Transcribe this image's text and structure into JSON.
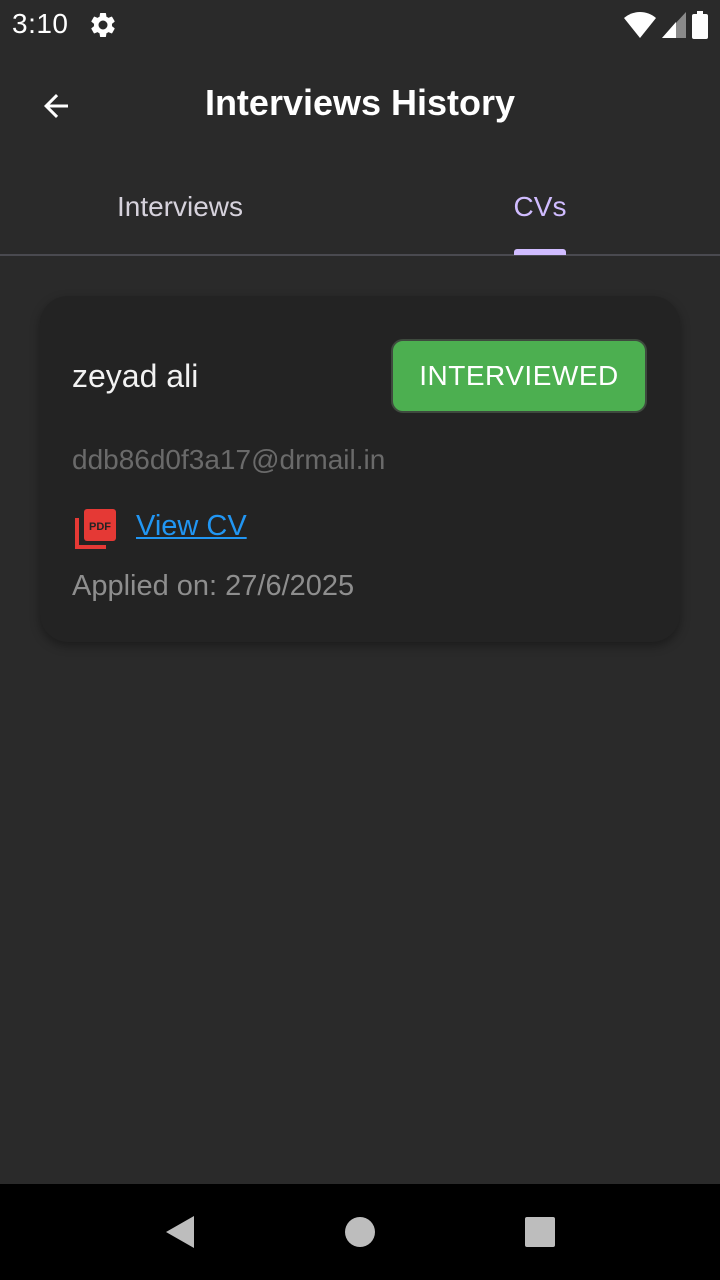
{
  "status_bar": {
    "time": "3:10",
    "icons": [
      "gear-icon",
      "wifi-icon",
      "signal-icon",
      "battery-icon"
    ]
  },
  "app_bar": {
    "title": "Interviews History",
    "back_icon": "arrow-left-icon"
  },
  "tabs": [
    {
      "label": "Interviews",
      "selected": false
    },
    {
      "label": "CVs",
      "selected": true
    }
  ],
  "cv_card": {
    "name": "zeyad ali",
    "status": "INTERVIEWED",
    "email": "ddb86d0f3a17@drmail.in",
    "cv_link_label": "View CV",
    "cv_icon": "pdf-icon",
    "applied_on": "Applied on: 27/6/2025"
  },
  "nav_bar": {
    "icons": [
      "back-triangle-icon",
      "home-circle-icon",
      "recents-square-icon"
    ]
  },
  "colors": {
    "background": "#2a2a2a",
    "card": "#232323",
    "accent": "#d0bcff",
    "status_green": "#4caf50",
    "link_blue": "#2196f3",
    "pdf_red": "#e53935"
  }
}
